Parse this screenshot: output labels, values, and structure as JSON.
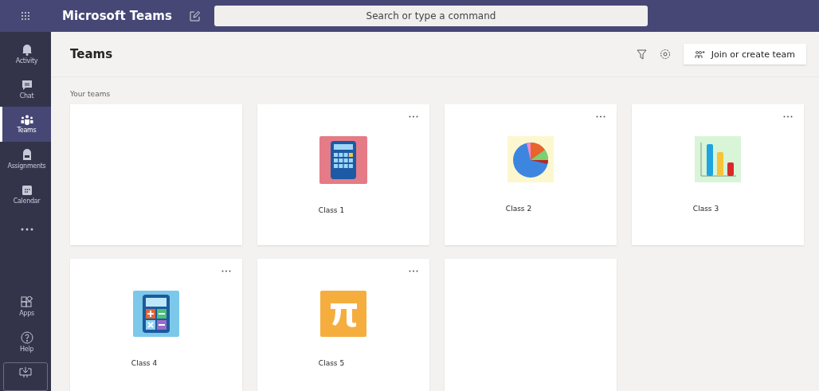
{
  "app_bar": {
    "title": "Microsoft Teams",
    "search": {
      "placeholder": "Search or type a command"
    }
  },
  "rail": {
    "items": [
      {
        "kind": "activity",
        "label": "Activity",
        "selected": false
      },
      {
        "kind": "chat",
        "label": "Chat",
        "selected": false
      },
      {
        "kind": "teams",
        "label": "Teams",
        "selected": true
      },
      {
        "kind": "assignments",
        "label": "Assignments",
        "selected": false
      },
      {
        "kind": "calendar",
        "label": "Calendar",
        "selected": false
      },
      {
        "kind": "more",
        "selected": false
      }
    ],
    "bottom_items": [
      {
        "kind": "apps",
        "label": "Apps"
      },
      {
        "kind": "help",
        "label": "Help"
      },
      {
        "kind": "download"
      }
    ]
  },
  "header": {
    "title": "Teams",
    "join_button": "Join or create team"
  },
  "section_label": "Your teams",
  "teams": [
    {
      "kind": "empty"
    },
    {
      "kind": "team",
      "name": "Class 1"
    },
    {
      "kind": "team",
      "name": "Class 2"
    },
    {
      "kind": "team",
      "name": "Class 3"
    },
    {
      "kind": "team",
      "name": "Class 4"
    },
    {
      "kind": "team",
      "name": "Class 5"
    },
    {
      "kind": "empty"
    }
  ]
}
